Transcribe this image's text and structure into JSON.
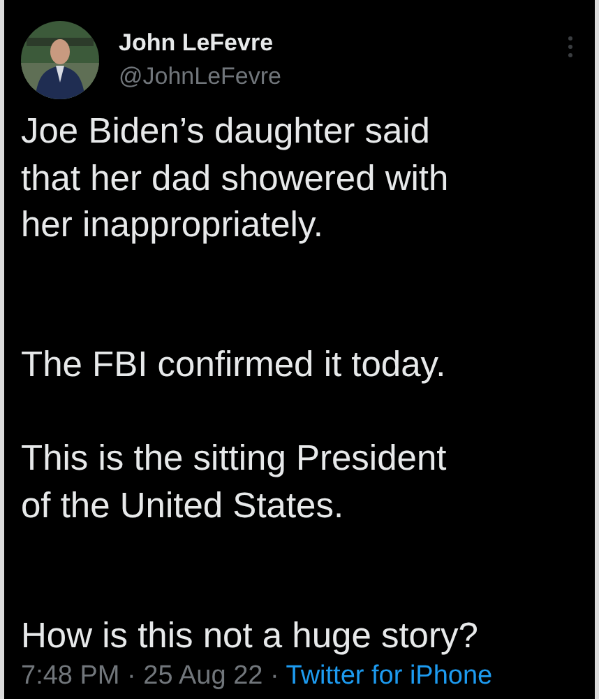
{
  "author": {
    "name": "John LeFevre",
    "handle": "@JohnLeFevre"
  },
  "paragraphs": [
    "Joe Biden’s daughter said\nthat her dad showered with\nher inappropriately.",
    "The FBI confirmed it today.",
    "This is the sitting President\nof the United States.",
    "How is this not a huge story?"
  ],
  "meta": {
    "timestamp": "7:48 PM · 25 Aug 22 · ",
    "source": "Twitter for iPhone"
  }
}
